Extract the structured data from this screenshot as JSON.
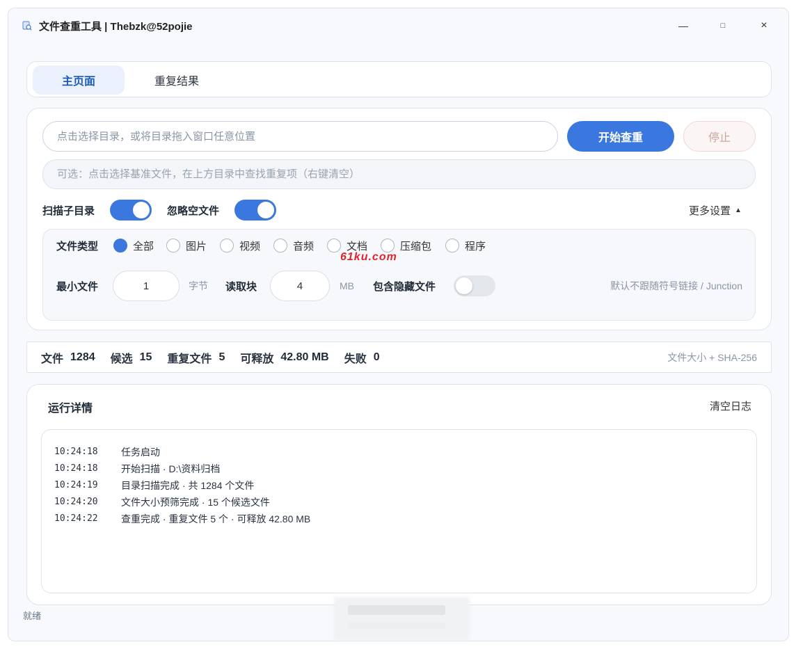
{
  "window": {
    "title": "文件查重工具 | Thebzk@52pojie",
    "controls": {
      "minimize": "—",
      "maximize": "□",
      "close": "×"
    }
  },
  "tabs": [
    {
      "label": "主页面",
      "active": true
    },
    {
      "label": "重复结果",
      "active": false
    }
  ],
  "main": {
    "dir_placeholder": "点击选择目录，或将目录拖入窗口任意位置",
    "start_label": "开始查重",
    "stop_label": "停止",
    "base_placeholder": "可选：点击选择基准文件，在上方目录中查找重复项（右键清空）",
    "scan_subdirs": {
      "label": "扫描子目录",
      "on": true
    },
    "ignore_empty": {
      "label": "忽略空文件",
      "on": true
    },
    "more_settings": "更多设置"
  },
  "settings": {
    "file_type_label": "文件类型",
    "file_types": [
      {
        "label": "全部",
        "checked": true
      },
      {
        "label": "图片",
        "checked": false
      },
      {
        "label": "视频",
        "checked": false
      },
      {
        "label": "音频",
        "checked": false
      },
      {
        "label": "文档",
        "checked": false
      },
      {
        "label": "压缩包",
        "checked": false
      },
      {
        "label": "程序",
        "checked": false
      }
    ],
    "min_file_label": "最小文件",
    "min_file_value": "1",
    "min_file_unit": "字节",
    "read_block_label": "读取块",
    "read_block_value": "4",
    "read_block_unit": "MB",
    "hidden_label": "包含隐藏文件",
    "hidden_on": false,
    "symlink_note": "默认不跟随符号链接 / Junction",
    "watermark": "61ku.com"
  },
  "stats": {
    "files_label": "文件",
    "files_value": "1284",
    "candidates_label": "候选",
    "candidates_value": "15",
    "dup_label": "重复文件",
    "dup_value": "5",
    "free_label": "可释放",
    "free_value": "42.80 MB",
    "fail_label": "失败",
    "fail_value": "0",
    "algorithm": "文件大小 + SHA-256"
  },
  "log": {
    "title": "运行详情",
    "clear_label": "清空日志",
    "entries": [
      {
        "time": "10:24:18",
        "msg": "任务启动"
      },
      {
        "time": "10:24:18",
        "msg": "开始扫描 · D:\\资料归档"
      },
      {
        "time": "10:24:19",
        "msg": "目录扫描完成 · 共 1284 个文件"
      },
      {
        "time": "10:24:20",
        "msg": "文件大小预筛完成 · 15 个候选文件"
      },
      {
        "time": "10:24:22",
        "msg": "查重完成 · 重复文件 5 个 · 可释放 42.80 MB"
      }
    ]
  },
  "status": "就绪",
  "colors": {
    "accent": "#3a78e0",
    "watermark": "#e0242b"
  }
}
